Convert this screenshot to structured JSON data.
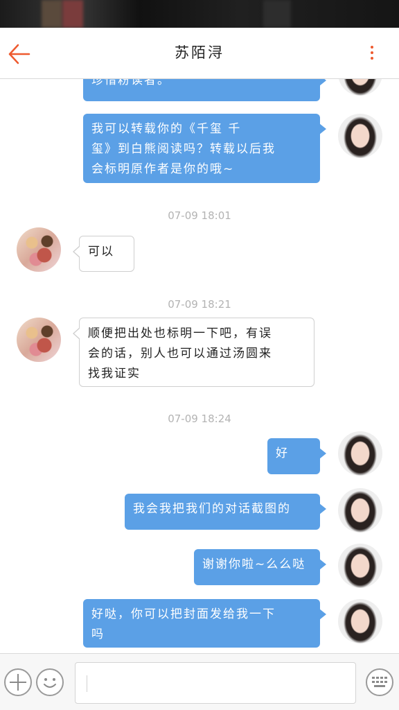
{
  "header": {
    "title": "苏陌浔"
  },
  "colors": {
    "accent": "#ee5a2f",
    "my_bubble": "#5ba0e6",
    "timestamp": "#b3b3b3"
  },
  "messages": [
    {
      "from": "me",
      "lines": [
        "珍惜粉读者。"
      ]
    },
    {
      "from": "me",
      "lines": [
        "我可以转载你的《千玺  千",
        "玺》到白熊阅读吗？转载以后我",
        "会标明原作者是你的哦~"
      ]
    },
    {
      "time": "07-09 18:01"
    },
    {
      "from": "other",
      "lines": [
        "可以"
      ]
    },
    {
      "time": "07-09 18:21"
    },
    {
      "from": "other",
      "lines": [
        "顺便把出处也标明一下吧，有误",
        "会的话，别人也可以通过汤圆来",
        "找我证实"
      ]
    },
    {
      "time": "07-09 18:24"
    },
    {
      "from": "me",
      "lines": [
        "好"
      ]
    },
    {
      "from": "me",
      "lines": [
        "我会我把我们的对话截图的"
      ]
    },
    {
      "from": "me",
      "lines": [
        "谢谢你啦~么么哒"
      ]
    },
    {
      "from": "me",
      "lines": [
        "好哒，你可以把封面发给我一下",
        "吗"
      ]
    }
  ],
  "input_bar": {
    "icons": [
      "add-icon",
      "emoji-icon",
      "keyboard-icon"
    ],
    "placeholder": ""
  }
}
